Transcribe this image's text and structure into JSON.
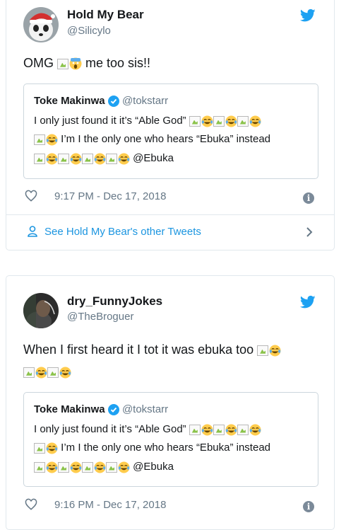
{
  "colors": {
    "accent": "#1da1f2",
    "link": "#1b95e0",
    "muted": "#657786",
    "border": "#e1e8ed"
  },
  "tweets": [
    {
      "name": "Hold My Bear",
      "handle": "@Silicylo",
      "text_a": "OMG",
      "text_b": "me too sis!!",
      "quote": {
        "name": "Toke Makinwa",
        "handle": "@tokstarr",
        "line1": "I only just found it it’s “Able God”",
        "line2": "I’m I the only one who hears  “Ebuka” instead",
        "line3_tail": "@Ebuka"
      },
      "time": "9:17 PM - Dec 17, 2018",
      "more": "See Hold My Bear's other Tweets"
    },
    {
      "name": "dry_FunnyJokes",
      "handle": "@TheBroguer",
      "text": "When I first heard it I tot it was ebuka too",
      "quote": {
        "name": "Toke Makinwa",
        "handle": "@tokstarr",
        "line1": "I only just found it it’s “Able God”",
        "line2": "I’m I the only one who hears  “Ebuka” instead",
        "line3_tail": "@Ebuka"
      },
      "time": "9:16 PM - Dec 17, 2018"
    }
  ]
}
